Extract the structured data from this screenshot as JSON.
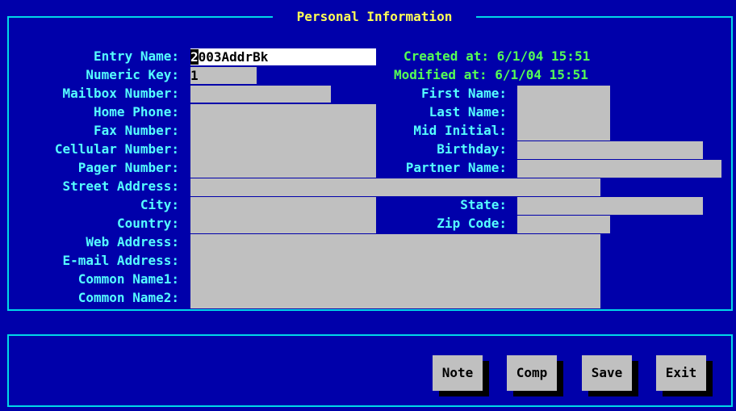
{
  "window": {
    "title": "Personal Information"
  },
  "form": {
    "left_labels": [
      "Entry Name:",
      "Numeric Key:",
      "Mailbox Number:",
      "Home Phone:",
      "Fax Number:",
      "Cellular Number:",
      "Pager Number:",
      "Street Address:",
      "City:",
      "Country:",
      "Web Address:",
      "E-mail Address:",
      "Common Name1:",
      "Common Name2:"
    ],
    "right_labels": [
      "First Name:",
      "Last Name:",
      "Mid Initial:",
      "Birthday:",
      "Partner Name:",
      "State:",
      "Zip Code:"
    ],
    "entry_name": {
      "cursor_char": "2",
      "rest": "003AddrBk"
    },
    "numeric_key": "1",
    "created_label": "Created at:",
    "created_value": "6/1/04 15:51",
    "modified_label": "Modified at:",
    "modified_value": "6/1/04 15:51"
  },
  "buttons": {
    "note": "Note",
    "comp": "Comp",
    "save": "Save",
    "exit": "Exit"
  },
  "colors": {
    "background": "#0000aa",
    "border": "#00d8e8",
    "label": "#55ffff",
    "title": "#ffff55",
    "stamp": "#55ff55",
    "field": "#c0c0c0",
    "active_field": "#ffffff"
  }
}
